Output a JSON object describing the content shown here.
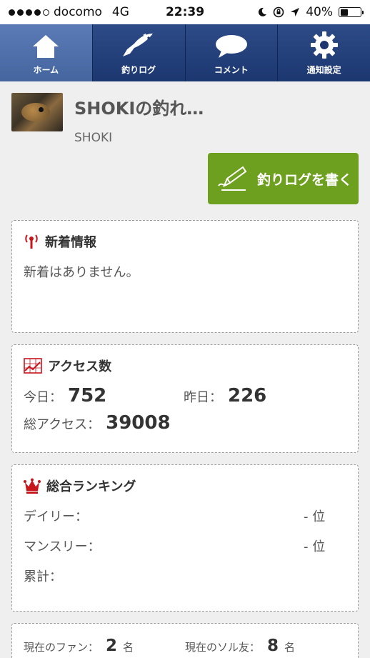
{
  "status_bar": {
    "carrier": "docomo",
    "network": "4G",
    "time": "22:39",
    "battery_text": "40%",
    "battery_level": 0.4
  },
  "nav": {
    "items": [
      {
        "label": "ホーム",
        "icon": "home-icon",
        "active": true
      },
      {
        "label": "釣りログ",
        "icon": "fish-icon",
        "active": false
      },
      {
        "label": "コメント",
        "icon": "speech-bubble-icon",
        "active": false
      },
      {
        "label": "通知設定",
        "icon": "gear-icon",
        "active": false
      }
    ]
  },
  "profile": {
    "blog_title": "SHOKIの釣れ…",
    "username": "SHOKI"
  },
  "write_button": {
    "label": "釣りログを書く",
    "icon": "pen-icon"
  },
  "news": {
    "title": "新着情報",
    "icon": "antenna-icon",
    "empty_text": "新着はありません。"
  },
  "access": {
    "title": "アクセス数",
    "icon": "chart-icon",
    "today_label": "今日：",
    "today_value": "752",
    "yesterday_label": "昨日：",
    "yesterday_value": "226",
    "total_label": "総アクセス：",
    "total_value": "39008"
  },
  "ranking": {
    "title": "総合ランキング",
    "icon": "crown-icon",
    "rows": [
      {
        "label": "デイリー：",
        "value": "- 位"
      },
      {
        "label": "マンスリー：",
        "value": "- 位"
      },
      {
        "label": "累計：",
        "value": ""
      }
    ]
  },
  "fans": {
    "fan_label": "現在のファン：",
    "fan_count": "2",
    "fan_unit": "名",
    "friend_label": "現在のソル友：",
    "friend_count": "8",
    "friend_unit": "名"
  },
  "colors": {
    "nav_bg": "#1c3770",
    "nav_active": "#5b7bb7",
    "write_button": "#6ea01f",
    "icon_red": "#c8161d"
  }
}
